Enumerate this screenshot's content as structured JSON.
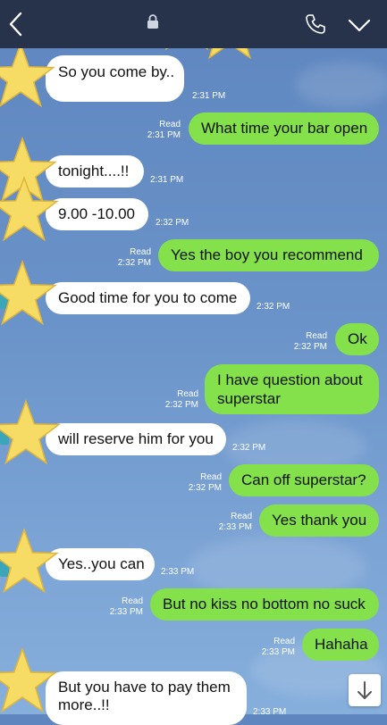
{
  "header": {
    "back_icon": "chevron-left-icon",
    "lock_icon": "lock-icon",
    "call_icon": "phone-icon",
    "menu_icon": "chevron-down-icon",
    "bar_color": "#26334b"
  },
  "colors": {
    "incoming_bubble": "#ffffff",
    "outgoing_bubble": "#84e14c",
    "background": "#6a93c9"
  },
  "messages": [
    {
      "dir": "in",
      "text": "So you come by..",
      "time": "2:31 PM"
    },
    {
      "dir": "out",
      "text": "What time your bar open",
      "read": "Read",
      "time": "2:31 PM"
    },
    {
      "dir": "in",
      "text": "tonight....!!",
      "time": "2:31 PM"
    },
    {
      "dir": "in",
      "text": "9.00 -10.00",
      "time": "2:32 PM"
    },
    {
      "dir": "out",
      "text": "Yes the boy you recommend",
      "read": "Read",
      "time": "2:32 PM"
    },
    {
      "dir": "in",
      "text": "Good time for you to come",
      "time": "2:32 PM"
    },
    {
      "dir": "out",
      "text": "Ok",
      "read": "Read",
      "time": "2:32 PM"
    },
    {
      "dir": "out",
      "text_line1": "I have question about",
      "text_line2": "superstar",
      "read": "Read",
      "time": "2:32 PM"
    },
    {
      "dir": "in",
      "text": "will reserve him for you",
      "time": "2:32 PM"
    },
    {
      "dir": "out",
      "text": "Can off superstar?",
      "read": "Read",
      "time": "2:32 PM"
    },
    {
      "dir": "out",
      "text": "Yes thank you",
      "read": "Read",
      "time": "2:33 PM"
    },
    {
      "dir": "in",
      "text": "Yes..you can",
      "time": "2:33 PM"
    },
    {
      "dir": "out",
      "text": "But no kiss no bottom no suck",
      "read": "Read",
      "time": "2:33 PM"
    },
    {
      "dir": "out",
      "text": "Hahaha",
      "read": "Read",
      "time": "2:33 PM"
    },
    {
      "dir": "in",
      "text_line1": "But you have to pay them",
      "text_line2": "more..!!",
      "time": "2:33 PM"
    }
  ],
  "scroll_button_icon": "arrow-down-icon"
}
